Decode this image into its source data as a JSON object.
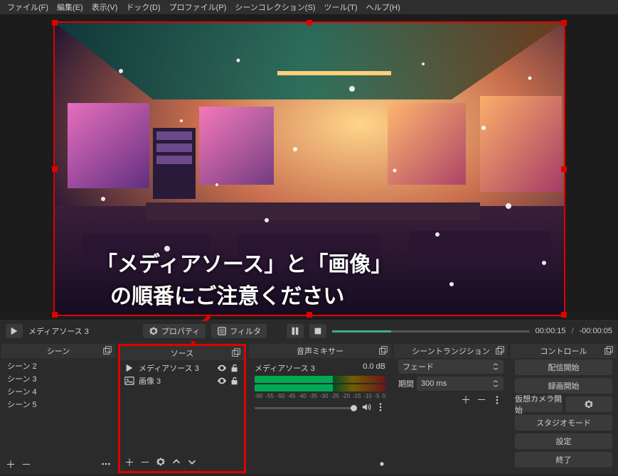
{
  "menu": {
    "file": "ファイル(F)",
    "edit": "編集(E)",
    "view": "表示(V)",
    "dock": "ドック(D)",
    "profile": "プロファイル(P)",
    "scene_collection": "シーンコレクション(S)",
    "tools": "ツール(T)",
    "help": "ヘルプ(H)"
  },
  "preview": {
    "selected_source": "メディアソース 3",
    "properties_btn": "プロパティ",
    "filters_btn": "フィルタ",
    "time_elapsed": "00:00:15",
    "time_remaining": "-00:00:05",
    "overlay_line1": "「メディアソース」と「画像」",
    "overlay_line2": "の順番にご注意ください"
  },
  "docks": {
    "scenes": {
      "title": "シーン",
      "items": [
        "シーン 2",
        "シーン 3",
        "シーン 4",
        "シーン 5"
      ]
    },
    "sources": {
      "title": "ソース",
      "items": [
        {
          "icon": "play",
          "label": "メディアソース 3"
        },
        {
          "icon": "image",
          "label": "画像 3"
        }
      ]
    },
    "mixer": {
      "title": "音声ミキサー",
      "source_name": "メディアソース 3",
      "db": "0.0 dB",
      "ticks": [
        "-60",
        "-55",
        "-50",
        "-45",
        "-40",
        "-35",
        "-30",
        "-25",
        "-20",
        "-15",
        "-10",
        "-5",
        "0"
      ]
    },
    "transitions": {
      "title": "シーントランジション",
      "type": "フェード",
      "duration_label": "期間",
      "duration_value": "300 ms"
    },
    "controls": {
      "title": "コントロール",
      "stream": "配信開始",
      "record": "録画開始",
      "vcam": "仮想カメラ開始",
      "studio": "スタジオモード",
      "settings": "設定",
      "exit": "終了"
    }
  }
}
